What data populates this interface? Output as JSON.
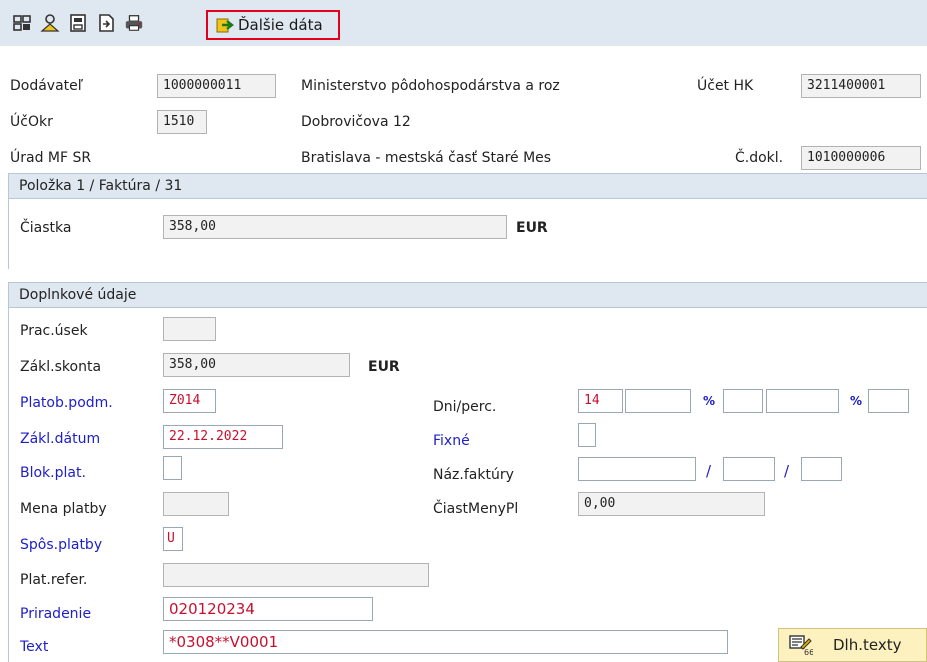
{
  "toolbar": {
    "icons": [
      "document-tree-icon",
      "user-icon",
      "save-document-icon",
      "export-document-icon",
      "print-icon"
    ],
    "more_data_label": "Ďalšie dáta"
  },
  "header": {
    "vendor_label": "Dodávateľ",
    "vendor_value": "1000000011",
    "vendor_name": "Ministerstvo pôdohospodárstva a roz",
    "gl_account_label": "Účet HK",
    "gl_account_value": "3211400001",
    "company_code_label": "ÚčOkr",
    "company_code_value": "1510",
    "street": "Dobrovičova 12",
    "office": "Úrad MF SR",
    "city": "Bratislava - mestská časť Staré Mes",
    "doc_no_label": "Č.dokl.",
    "doc_no_value": "1010000006"
  },
  "item_section": {
    "title": "Položka 1 / Faktúra / 31",
    "amount_label": "Čiastka",
    "amount_value": "358,00",
    "currency": "EUR"
  },
  "extra_section": {
    "title": "Doplnkové údaje",
    "business_area_label": "Prac.úsek",
    "business_area_value": "",
    "discount_base_label": "Zákl.skonta",
    "discount_base_value": "358,00",
    "discount_currency": "EUR",
    "payment_terms_label": "Platob.podm.",
    "payment_terms_value": "Z014",
    "days_pct_label": "Dni/perc.",
    "days1_value": "14",
    "pct_symbol": "%",
    "baseline_date_label": "Zákl.dátum",
    "baseline_date_value": "22.12.2022",
    "fixed_label": "Fixné",
    "payment_block_label": "Blok.plat.",
    "invoice_ref_label": "Náz.faktúry",
    "slash": "/",
    "payment_currency_label": "Mena platby",
    "payment_currency_amount_label": "ČiastMenyPl",
    "payment_currency_amount_value": "0,00",
    "payment_method_label": "Spôs.platby",
    "payment_method_value": "U",
    "payment_ref_label": "Plat.refer.",
    "assignment_label": "Priradenie",
    "assignment_value": "020120234",
    "text_label": "Text",
    "text_value": "*0308**V0001",
    "long_texts_label": "Dlh.texty"
  }
}
